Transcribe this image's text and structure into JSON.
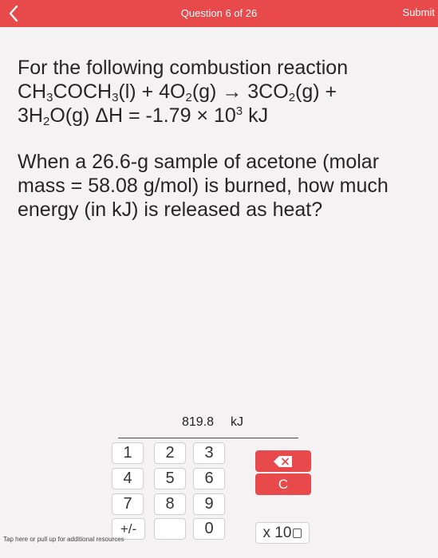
{
  "header": {
    "title": "Question 6 of 26",
    "submit_label": "Submit",
    "accent_color": "#e84a4c"
  },
  "question": {
    "intro": "For the following combustion reaction",
    "equation": {
      "reactant1": [
        "CH",
        "3",
        "COCH",
        "3",
        "(l)"
      ],
      "plus1": " + 4O",
      "o2_sub": "2",
      "o2_state": "(g)",
      "arrow": " → ",
      "co2_prefix": "3CO",
      "co2_sub": "2",
      "co2_state": "(g) +",
      "h2o_prefix": "3H",
      "h2o_sub": "2",
      "h2o_state": "O(g) ΔH = -1.79 × 10",
      "exp": "3",
      "unit": " kJ"
    },
    "prompt": "When a 26.6-g sample of acetone (molar mass = 58.08 g/mol) is burned, how much energy (in kJ) is released as heat?"
  },
  "answer": {
    "value": "819.8",
    "unit": "kJ"
  },
  "keypad": {
    "k1": "1",
    "k2": "2",
    "k3": "3",
    "k4": "4",
    "k5": "5",
    "k6": "6",
    "k7": "7",
    "k8": "8",
    "k9": "9",
    "k0": "0",
    "plus_minus": "+/-",
    "clear": "C",
    "times_ten": "x 10"
  },
  "footer": {
    "hint": "Tap here or pull up for additional resources"
  }
}
